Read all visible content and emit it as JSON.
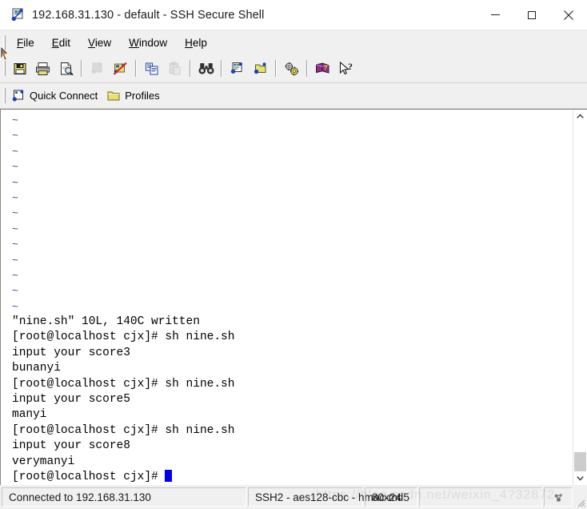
{
  "window": {
    "title": "192.168.31.130 - default - SSH Secure Shell",
    "icon": "ssh-terminal-icon",
    "caption": {
      "minimize_label": "Minimize",
      "maximize_label": "Maximize",
      "close_label": "Close"
    }
  },
  "menu": {
    "items": [
      {
        "label": "File",
        "accel": "F"
      },
      {
        "label": "Edit",
        "accel": "E"
      },
      {
        "label": "View",
        "accel": "V"
      },
      {
        "label": "Window",
        "accel": "W"
      },
      {
        "label": "Help",
        "accel": "H"
      }
    ]
  },
  "toolbar": {
    "buttons": [
      {
        "name": "save-icon",
        "tooltip": "Save"
      },
      {
        "name": "print-icon",
        "tooltip": "Print"
      },
      {
        "name": "print-preview-icon",
        "tooltip": "Print Preview"
      },
      {
        "name": "connect-icon",
        "tooltip": "Connect",
        "disabled": true
      },
      {
        "name": "disconnect-icon",
        "tooltip": "Disconnect"
      },
      {
        "name": "copy-icon",
        "tooltip": "Copy"
      },
      {
        "name": "paste-icon",
        "tooltip": "Paste",
        "disabled": true
      },
      {
        "name": "find-icon",
        "tooltip": "Find"
      },
      {
        "name": "new-terminal-icon",
        "tooltip": "New Terminal"
      },
      {
        "name": "new-file-transfer-icon",
        "tooltip": "New File Transfer"
      },
      {
        "name": "settings-icon",
        "tooltip": "Settings"
      },
      {
        "name": "help-book-icon",
        "tooltip": "Help"
      },
      {
        "name": "context-help-icon",
        "tooltip": "Context Help"
      }
    ]
  },
  "quick_connect_bar": {
    "quick_connect_label": "Quick Connect",
    "profiles_label": "Profiles"
  },
  "terminal": {
    "tilde_symbol": "~",
    "tilde_rows": 13,
    "lines": [
      "\"nine.sh\" 10L, 140C written",
      "[root@localhost cjx]# sh nine.sh",
      "input your score3",
      "bunanyi",
      "[root@localhost cjx]# sh nine.sh",
      "input your score5",
      "manyi",
      "[root@localhost cjx]# sh nine.sh",
      "input your score8",
      "verymanyi"
    ],
    "prompt": "[root@localhost cjx]# ",
    "cursor_color": "#0000ee",
    "background": "#ffffff",
    "foreground": "#000000"
  },
  "scrollbar": {
    "up_arrow": "▲",
    "down_arrow": "▼"
  },
  "status_bar": {
    "connection": "Connected to 192.168.31.130",
    "cipher": "SSH2 - aes128-cbc - hmac-md5",
    "size": "80x24",
    "icon": "ssh-status-icon"
  },
  "watermark": {
    "text": "https://blog.csdn.net/weixin_4?32872"
  }
}
